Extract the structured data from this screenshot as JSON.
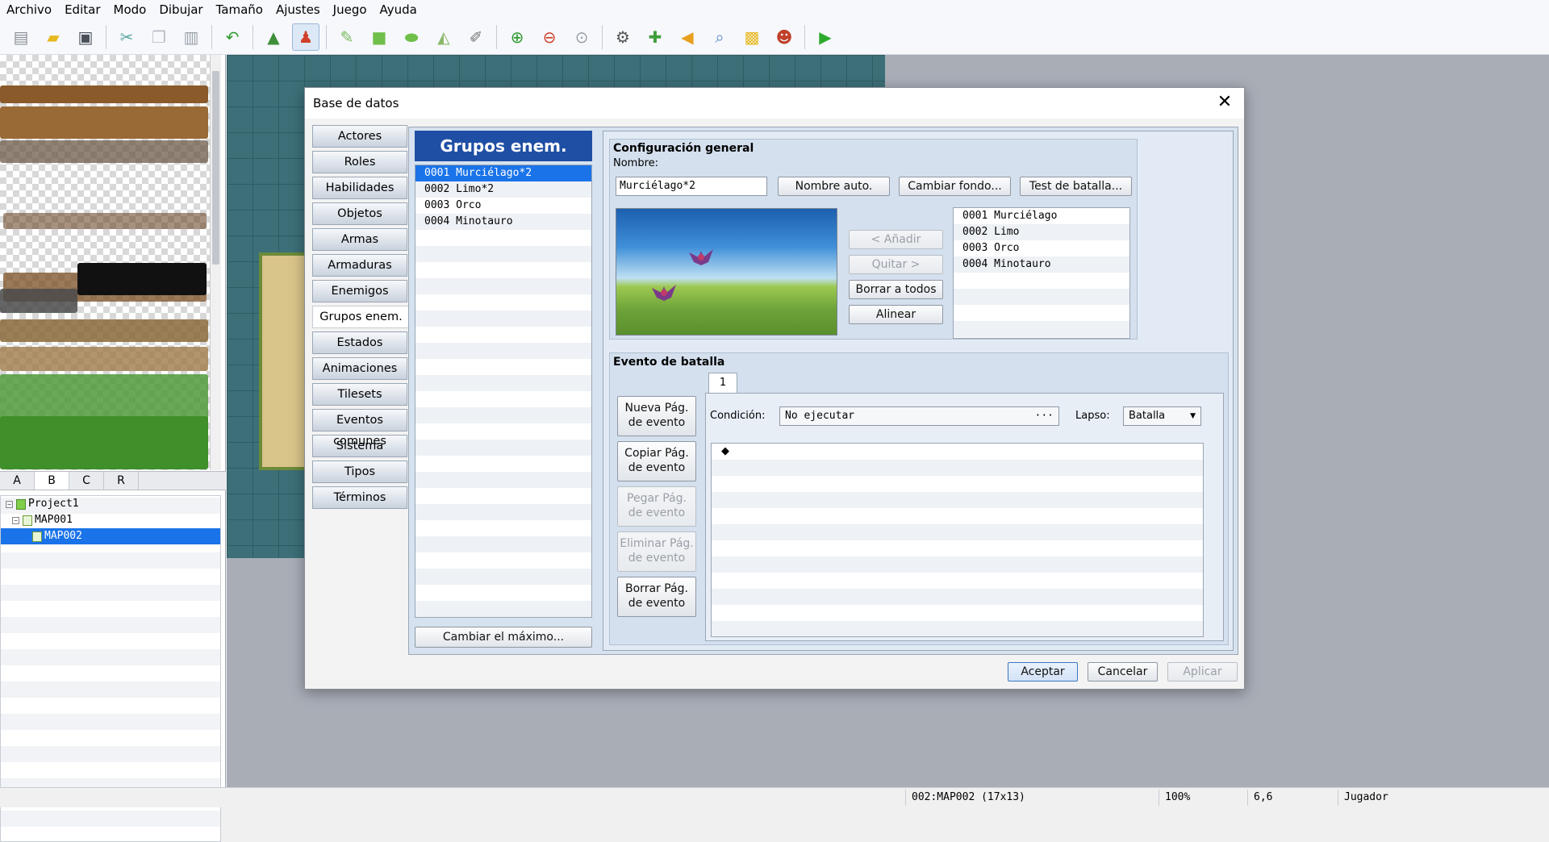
{
  "menu": [
    "Archivo",
    "Editar",
    "Modo",
    "Dibujar",
    "Tamaño",
    "Ajustes",
    "Juego",
    "Ayuda"
  ],
  "toolbar": {
    "icons": [
      "new-project-icon",
      "open-project-icon",
      "save-icon",
      "cut-icon",
      "copy-icon",
      "paste-icon",
      "undo-icon",
      "map-mode-icon",
      "event-mode-icon",
      "pencil-icon",
      "rectangle-icon",
      "ellipse-icon",
      "fill-icon",
      "shadow-pen-icon",
      "zoom-in-icon",
      "zoom-out-icon",
      "zoom-actual-icon",
      "database-icon",
      "plugin-manager-icon",
      "sound-test-icon",
      "event-search-icon",
      "resource-manager-icon",
      "character-generator-icon",
      "playtest-icon"
    ]
  },
  "tile_tabs": [
    "A",
    "B",
    "C",
    "R"
  ],
  "tile_tab_selected": "B",
  "tree": {
    "project": "Project1",
    "maps": [
      "MAP001",
      "MAP002"
    ],
    "selected": "MAP002"
  },
  "status": {
    "map": "002:MAP002 (17x13)",
    "zoom": "100%",
    "coords": "6,6",
    "target": "Jugador"
  },
  "dialog": {
    "title": "Base de datos",
    "close": "✕",
    "categories": [
      "Actores",
      "Roles",
      "Habilidades",
      "Objetos",
      "Armas",
      "Armaduras",
      "Enemigos",
      "Grupos enem.",
      "Estados",
      "Animaciones",
      "Tilesets",
      "Eventos comunes",
      "Sistema",
      "Tipos",
      "Términos"
    ],
    "selected_category": "Grupos enem.",
    "groups_header": "Grupos enem.",
    "groups": [
      "0001 Murciélago*2",
      "0002 Limo*2",
      "0003 Orco",
      "0004 Minotauro"
    ],
    "change_max": "Cambiar el máximo...",
    "general": {
      "title": "Configuración general",
      "name_label": "Nombre:",
      "name_value": "Murciélago*2",
      "auto_name": "Nombre auto.",
      "change_bg": "Cambiar fondo...",
      "battle_test": "Test de batalla...",
      "add": "< Añadir",
      "remove": "Quitar >",
      "clear_all": "Borrar a todos",
      "align": "Alinear",
      "enemies": [
        "0001 Murciélago",
        "0002 Limo",
        "0003 Orco",
        "0004 Minotauro"
      ]
    },
    "battle_event": {
      "title": "Evento de batalla",
      "tab": "1",
      "new_page": [
        "Nueva Pág.",
        "de evento"
      ],
      "copy_page": [
        "Copiar Pág.",
        "de evento"
      ],
      "paste_page": [
        "Pegar Pág.",
        "de evento"
      ],
      "delete_page": [
        "Eliminar Pág.",
        "de evento"
      ],
      "clear_page": [
        "Borrar Pág.",
        "de evento"
      ],
      "condition_label": "Condición:",
      "condition_value": "No ejecutar",
      "condition_more": "···",
      "span_label": "Lapso:",
      "span_value": "Batalla",
      "first_command": "◆"
    },
    "ok": "Aceptar",
    "cancel": "Cancelar",
    "apply": "Aplicar"
  }
}
